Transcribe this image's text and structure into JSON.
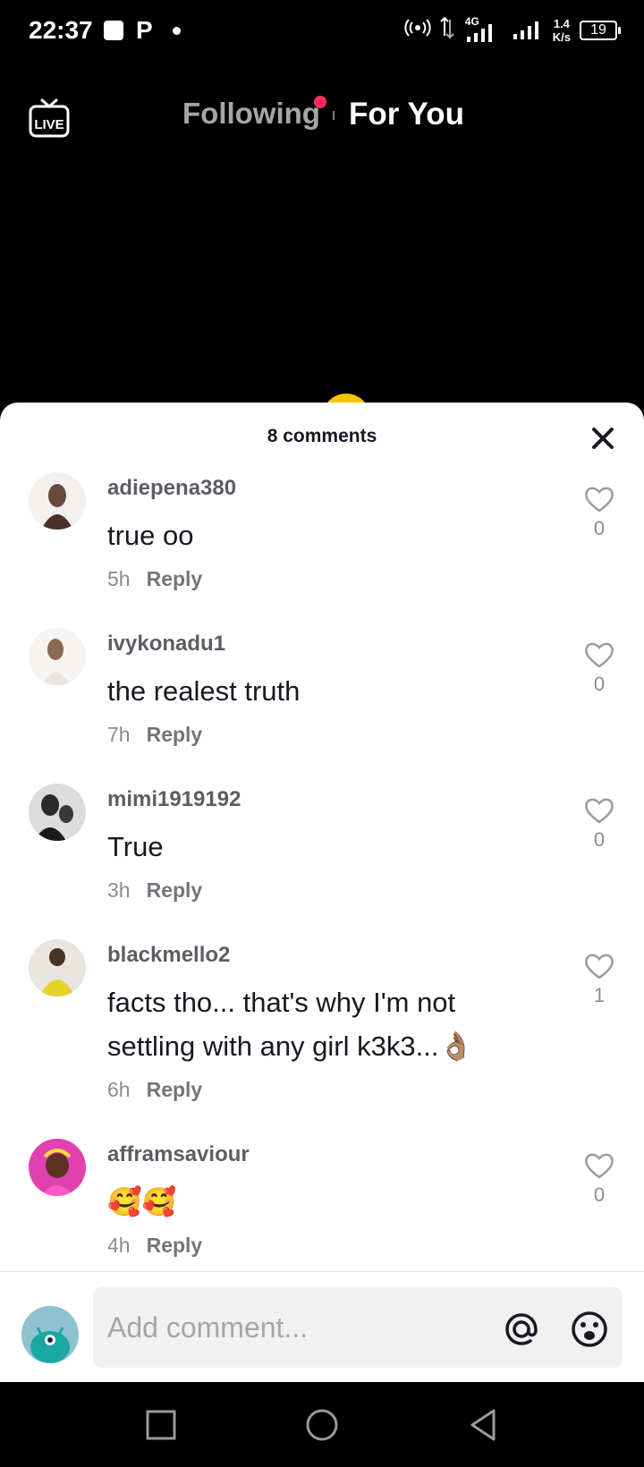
{
  "status_bar": {
    "time": "22:37",
    "net_speed_value": "1.4",
    "net_speed_unit": "K/s",
    "network_label": "4G",
    "battery_level": "19"
  },
  "top_nav": {
    "tabs": [
      "Following",
      "For You"
    ],
    "live_label": "LIVE"
  },
  "comments_sheet": {
    "title": "8 comments",
    "comments": [
      {
        "username": "adiepena380",
        "text": "true oo",
        "time": "5h",
        "reply": "Reply",
        "likes": "0"
      },
      {
        "username": "ivykonadu1",
        "text": "the realest truth",
        "time": "7h",
        "reply": "Reply",
        "likes": "0"
      },
      {
        "username": "mimi1919192",
        "text": "True",
        "time": "3h",
        "reply": "Reply",
        "likes": "0"
      },
      {
        "username": "blackmello2",
        "text": "facts tho... that's why I'm not settling with any girl k3k3...👌🏽",
        "time": "6h",
        "reply": "Reply",
        "likes": "1"
      },
      {
        "username": "afframsaviour",
        "text": "🥰🥰",
        "time": "4h",
        "reply": "Reply",
        "likes": "0"
      }
    ]
  },
  "input": {
    "placeholder": "Add comment..."
  },
  "colors": {
    "accent_red": "#fe2c55",
    "text_primary": "#161823",
    "input_bg": "#f1f1f2"
  }
}
